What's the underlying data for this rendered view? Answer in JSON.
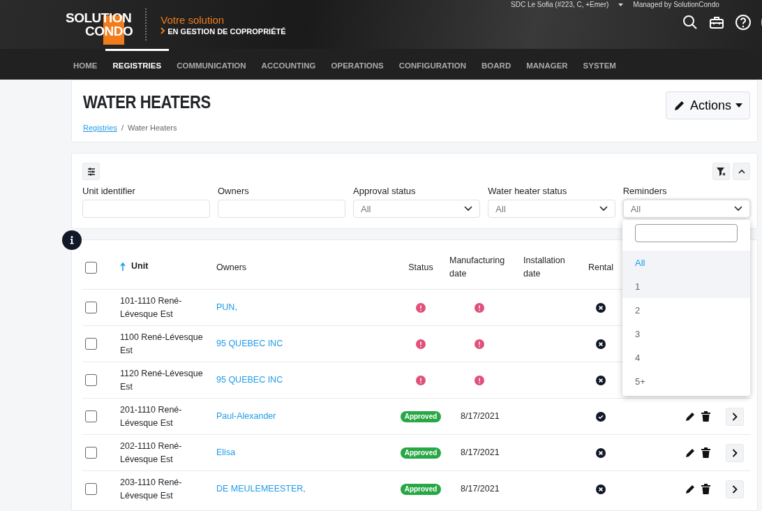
{
  "header": {
    "logo": {
      "line1": "SOLUTION",
      "line2": "CONDO"
    },
    "tagline": "Votre solution",
    "tagline_sub": "EN GESTION DE COPROPRIÉTÉ",
    "account": "SDC Le Sofia (#223, C, +Emer)",
    "managed_by": "Managed by SolutionCondo"
  },
  "nav": [
    {
      "label": "HOME",
      "selected": false
    },
    {
      "label": "REGISTRIES",
      "selected": true
    },
    {
      "label": "COMMUNICATION",
      "selected": false
    },
    {
      "label": "ACCOUNTING",
      "selected": false
    },
    {
      "label": "OPERATIONS",
      "selected": false
    },
    {
      "label": "CONFIGURATION",
      "selected": false
    },
    {
      "label": "BOARD",
      "selected": false
    },
    {
      "label": "MANAGER",
      "selected": false
    },
    {
      "label": "SYSTEM",
      "selected": false
    }
  ],
  "page": {
    "title": "WATER HEATERS",
    "actions_button": "Actions",
    "breadcrumb_separator": "/",
    "breadcrumb": [
      {
        "label": "Registries",
        "kind": "link"
      },
      {
        "label": "Water Heaters",
        "kind": "current"
      }
    ]
  },
  "filters": [
    {
      "label": "Unit identifier",
      "kind": "text"
    },
    {
      "label": "Owners",
      "kind": "text"
    },
    {
      "label": "Approval status",
      "kind": "select",
      "value": "All"
    },
    {
      "label": "Water heater status",
      "kind": "select",
      "value": "All"
    },
    {
      "label": "Reminders",
      "kind": "select",
      "value": "All",
      "expanded": true
    }
  ],
  "reminders_dropdown": {
    "options": [
      {
        "label": "All",
        "selected": true,
        "highlighted": true
      },
      {
        "label": "1",
        "selected": false,
        "highlighted": true
      },
      {
        "label": "2",
        "selected": false,
        "highlighted": false
      },
      {
        "label": "3",
        "selected": false,
        "highlighted": false
      },
      {
        "label": "4",
        "selected": false,
        "highlighted": false
      },
      {
        "label": "5+",
        "selected": false,
        "highlighted": false
      }
    ]
  },
  "table": {
    "select_all_checked": false,
    "columns": [
      "Unit",
      "Owners",
      "Status",
      "Manufacturing date",
      "Installation date",
      "Rental"
    ],
    "rows": [
      {
        "unit": "101-1110 René-Lévesque Est",
        "owners": "PUN,",
        "status": {
          "kind": "alert"
        },
        "manufacturing": {
          "kind": "alert"
        },
        "rental": false,
        "checked": false
      },
      {
        "unit": "1100 René-Lévesque Est",
        "owners": "95 QUEBEC INC",
        "status": {
          "kind": "alert"
        },
        "manufacturing": {
          "kind": "alert"
        },
        "rental": false,
        "checked": false
      },
      {
        "unit": "1120 René-Lévesque Est",
        "owners": "95 QUEBEC INC",
        "status": {
          "kind": "alert"
        },
        "manufacturing": {
          "kind": "alert"
        },
        "rental": false,
        "checked": false
      },
      {
        "unit": "201-1110 René-Lévesque Est",
        "owners": "Paul-Alexander",
        "status": {
          "kind": "badge",
          "label": "Approved"
        },
        "manufacturing": {
          "kind": "date",
          "label": "8/17/2021"
        },
        "rental": true,
        "checked": false
      },
      {
        "unit": "202-1110 René-Lévesque Est",
        "owners": "Elisa",
        "status": {
          "kind": "badge",
          "label": "Approved"
        },
        "manufacturing": {
          "kind": "date",
          "label": "8/17/2021"
        },
        "rental": false,
        "checked": false
      },
      {
        "unit": "203-1110 René-Lévesque Est",
        "owners": "DE MEULEMEESTER,",
        "status": {
          "kind": "badge",
          "label": "Approved"
        },
        "manufacturing": {
          "kind": "date",
          "label": "8/17/2021"
        },
        "rental": false,
        "checked": false
      }
    ]
  }
}
